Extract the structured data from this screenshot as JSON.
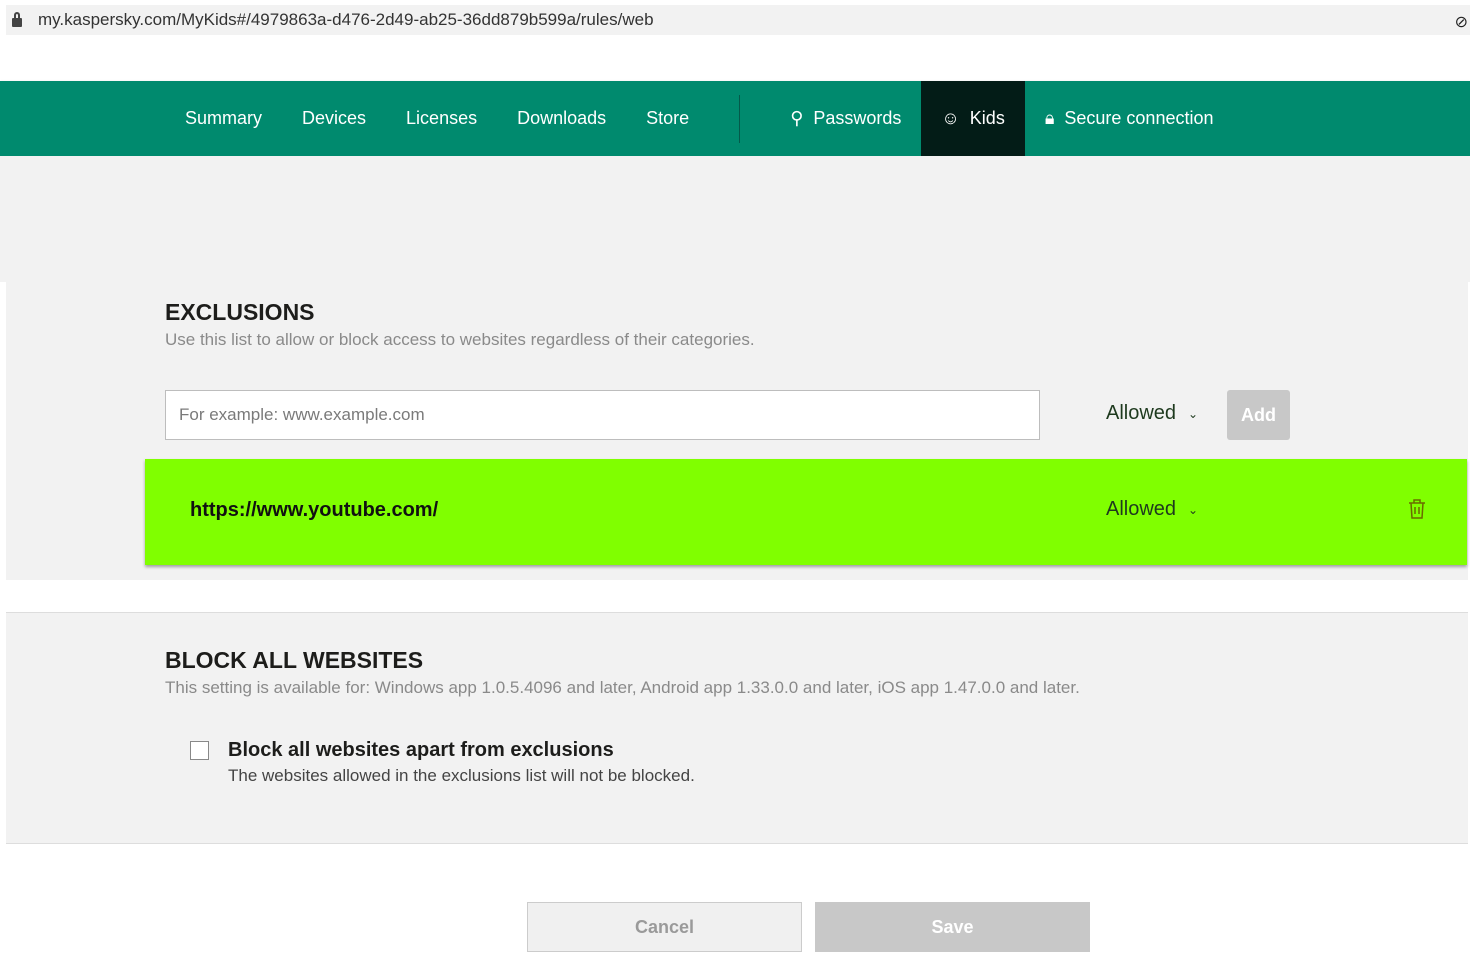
{
  "browser": {
    "url": "my.kaspersky.com/MyKids#/4979863a-d476-2d49-ab25-36dd879b599a/rules/web"
  },
  "nav": {
    "items": [
      "Summary",
      "Devices",
      "Licenses",
      "Downloads",
      "Store"
    ],
    "passwords": "Passwords",
    "kids": "Kids",
    "secure": "Secure connection"
  },
  "exclusions": {
    "title": "EXCLUSIONS",
    "description": "Use this list to allow or block access to websites regardless of their categories.",
    "input_placeholder": "For example: www.example.com",
    "input_value": "",
    "select_value": "Allowed",
    "add_label": "Add",
    "rows": [
      {
        "url": "https://www.youtube.com/",
        "status": "Allowed"
      }
    ]
  },
  "block_all": {
    "title": "BLOCK ALL WEBSITES",
    "description": "This setting is available for: Windows app 1.0.5.4096 and later, Android app 1.33.0.0 and later, iOS app 1.47.0.0 and later.",
    "checkbox_label": "Block all websites apart from exclusions",
    "checkbox_hint": "The websites allowed in the exclusions list will not be blocked.",
    "checked": false
  },
  "footer": {
    "cancel": "Cancel",
    "save": "Save"
  },
  "colors": {
    "nav": "#008a6e",
    "highlight": "#80ff00"
  }
}
